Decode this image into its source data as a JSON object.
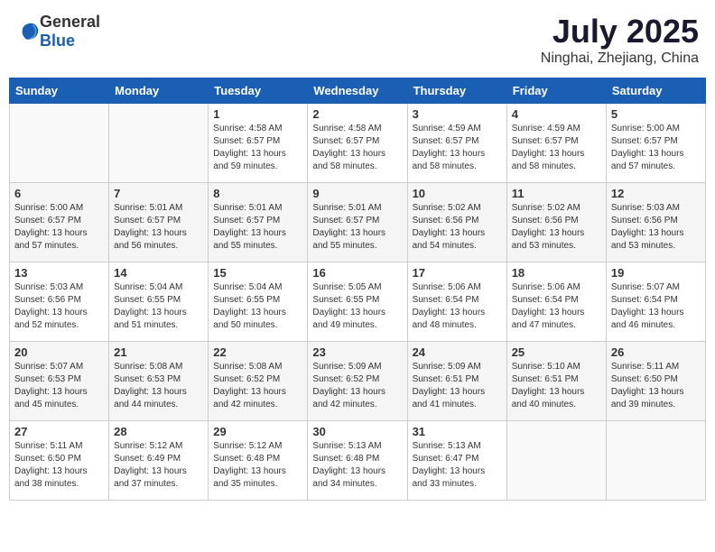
{
  "header": {
    "logo_general": "General",
    "logo_blue": "Blue",
    "title": "July 2025",
    "location": "Ninghai, Zhejiang, China"
  },
  "weekdays": [
    "Sunday",
    "Monday",
    "Tuesday",
    "Wednesday",
    "Thursday",
    "Friday",
    "Saturday"
  ],
  "weeks": [
    [
      {
        "day": "",
        "info": ""
      },
      {
        "day": "",
        "info": ""
      },
      {
        "day": "1",
        "info": "Sunrise: 4:58 AM\nSunset: 6:57 PM\nDaylight: 13 hours and 59 minutes."
      },
      {
        "day": "2",
        "info": "Sunrise: 4:58 AM\nSunset: 6:57 PM\nDaylight: 13 hours and 58 minutes."
      },
      {
        "day": "3",
        "info": "Sunrise: 4:59 AM\nSunset: 6:57 PM\nDaylight: 13 hours and 58 minutes."
      },
      {
        "day": "4",
        "info": "Sunrise: 4:59 AM\nSunset: 6:57 PM\nDaylight: 13 hours and 58 minutes."
      },
      {
        "day": "5",
        "info": "Sunrise: 5:00 AM\nSunset: 6:57 PM\nDaylight: 13 hours and 57 minutes."
      }
    ],
    [
      {
        "day": "6",
        "info": "Sunrise: 5:00 AM\nSunset: 6:57 PM\nDaylight: 13 hours and 57 minutes."
      },
      {
        "day": "7",
        "info": "Sunrise: 5:01 AM\nSunset: 6:57 PM\nDaylight: 13 hours and 56 minutes."
      },
      {
        "day": "8",
        "info": "Sunrise: 5:01 AM\nSunset: 6:57 PM\nDaylight: 13 hours and 55 minutes."
      },
      {
        "day": "9",
        "info": "Sunrise: 5:01 AM\nSunset: 6:57 PM\nDaylight: 13 hours and 55 minutes."
      },
      {
        "day": "10",
        "info": "Sunrise: 5:02 AM\nSunset: 6:56 PM\nDaylight: 13 hours and 54 minutes."
      },
      {
        "day": "11",
        "info": "Sunrise: 5:02 AM\nSunset: 6:56 PM\nDaylight: 13 hours and 53 minutes."
      },
      {
        "day": "12",
        "info": "Sunrise: 5:03 AM\nSunset: 6:56 PM\nDaylight: 13 hours and 53 minutes."
      }
    ],
    [
      {
        "day": "13",
        "info": "Sunrise: 5:03 AM\nSunset: 6:56 PM\nDaylight: 13 hours and 52 minutes."
      },
      {
        "day": "14",
        "info": "Sunrise: 5:04 AM\nSunset: 6:55 PM\nDaylight: 13 hours and 51 minutes."
      },
      {
        "day": "15",
        "info": "Sunrise: 5:04 AM\nSunset: 6:55 PM\nDaylight: 13 hours and 50 minutes."
      },
      {
        "day": "16",
        "info": "Sunrise: 5:05 AM\nSunset: 6:55 PM\nDaylight: 13 hours and 49 minutes."
      },
      {
        "day": "17",
        "info": "Sunrise: 5:06 AM\nSunset: 6:54 PM\nDaylight: 13 hours and 48 minutes."
      },
      {
        "day": "18",
        "info": "Sunrise: 5:06 AM\nSunset: 6:54 PM\nDaylight: 13 hours and 47 minutes."
      },
      {
        "day": "19",
        "info": "Sunrise: 5:07 AM\nSunset: 6:54 PM\nDaylight: 13 hours and 46 minutes."
      }
    ],
    [
      {
        "day": "20",
        "info": "Sunrise: 5:07 AM\nSunset: 6:53 PM\nDaylight: 13 hours and 45 minutes."
      },
      {
        "day": "21",
        "info": "Sunrise: 5:08 AM\nSunset: 6:53 PM\nDaylight: 13 hours and 44 minutes."
      },
      {
        "day": "22",
        "info": "Sunrise: 5:08 AM\nSunset: 6:52 PM\nDaylight: 13 hours and 42 minutes."
      },
      {
        "day": "23",
        "info": "Sunrise: 5:09 AM\nSunset: 6:52 PM\nDaylight: 13 hours and 42 minutes."
      },
      {
        "day": "24",
        "info": "Sunrise: 5:09 AM\nSunset: 6:51 PM\nDaylight: 13 hours and 41 minutes."
      },
      {
        "day": "25",
        "info": "Sunrise: 5:10 AM\nSunset: 6:51 PM\nDaylight: 13 hours and 40 minutes."
      },
      {
        "day": "26",
        "info": "Sunrise: 5:11 AM\nSunset: 6:50 PM\nDaylight: 13 hours and 39 minutes."
      }
    ],
    [
      {
        "day": "27",
        "info": "Sunrise: 5:11 AM\nSunset: 6:50 PM\nDaylight: 13 hours and 38 minutes."
      },
      {
        "day": "28",
        "info": "Sunrise: 5:12 AM\nSunset: 6:49 PM\nDaylight: 13 hours and 37 minutes."
      },
      {
        "day": "29",
        "info": "Sunrise: 5:12 AM\nSunset: 6:48 PM\nDaylight: 13 hours and 35 minutes."
      },
      {
        "day": "30",
        "info": "Sunrise: 5:13 AM\nSunset: 6:48 PM\nDaylight: 13 hours and 34 minutes."
      },
      {
        "day": "31",
        "info": "Sunrise: 5:13 AM\nSunset: 6:47 PM\nDaylight: 13 hours and 33 minutes."
      },
      {
        "day": "",
        "info": ""
      },
      {
        "day": "",
        "info": ""
      }
    ]
  ]
}
